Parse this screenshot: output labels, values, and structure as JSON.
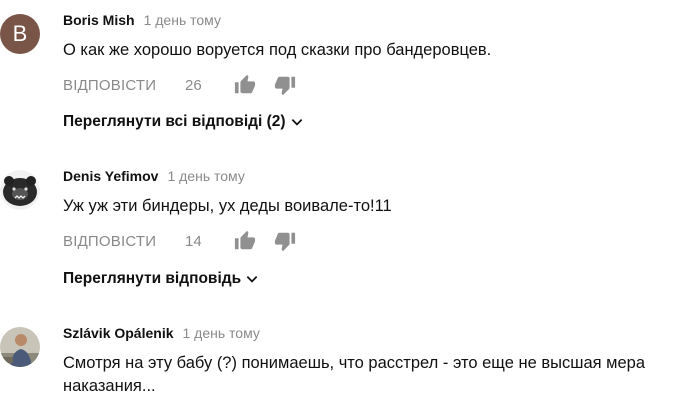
{
  "comments": [
    {
      "avatar_letter": "B",
      "author": "Boris Mish",
      "time": "1 день тому",
      "text": "О как же хорошо воруется под сказки про бандеровцев.",
      "reply_label": "ВІДПОВІСТИ",
      "likes": "26",
      "view_replies": "Переглянути всі відповіді (2)"
    },
    {
      "author": "Denis Yefimov",
      "time": "1 день тому",
      "text": "Уж уж эти биндеры, ух деды воивале-то!11",
      "reply_label": "ВІДПОВІСТИ",
      "likes": "14",
      "view_replies": "Переглянути відповідь"
    },
    {
      "author": "Szlávik Opálenik",
      "time": "1 день тому",
      "text": "Смотря на эту бабу (?) понимаешь, что расстрел - это еще не высшая мера наказания..."
    }
  ],
  "colors": {
    "avatar_b": "#795548",
    "secondary_text": "#8a8a8a",
    "icon": "#909090"
  },
  "icons": {
    "like": "thumb-up-icon",
    "dislike": "thumb-down-icon",
    "expand": "chevron-down-icon"
  }
}
